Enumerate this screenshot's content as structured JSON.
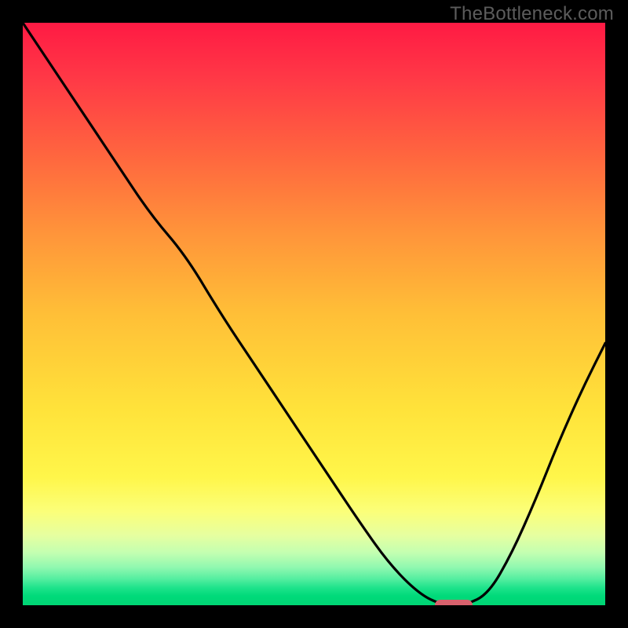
{
  "watermark": "TheBottleneck.com",
  "chart_data": {
    "type": "line",
    "title": "",
    "xlabel": "",
    "ylabel": "",
    "xlim": [
      0,
      100
    ],
    "ylim": [
      0,
      100
    ],
    "grid": false,
    "bg_gradient": [
      {
        "pos": 0,
        "color": "#ff1a44"
      },
      {
        "pos": 50,
        "color": "#ffbf37"
      },
      {
        "pos": 78,
        "color": "#fff64a"
      },
      {
        "pos": 100,
        "color": "#00d574"
      }
    ],
    "x": [
      0,
      4,
      10,
      16,
      22,
      28,
      34,
      40,
      46,
      52,
      58,
      63,
      68,
      72,
      76,
      80,
      84,
      88,
      92,
      96,
      100
    ],
    "values": [
      100,
      94,
      85,
      76,
      67,
      60,
      50,
      41,
      32,
      23,
      14,
      7,
      2,
      0,
      0,
      2,
      9,
      18,
      28,
      37,
      45
    ],
    "marker": {
      "x": 74,
      "y": 0,
      "width_pct": 6.5,
      "color": "#d8616d"
    }
  }
}
